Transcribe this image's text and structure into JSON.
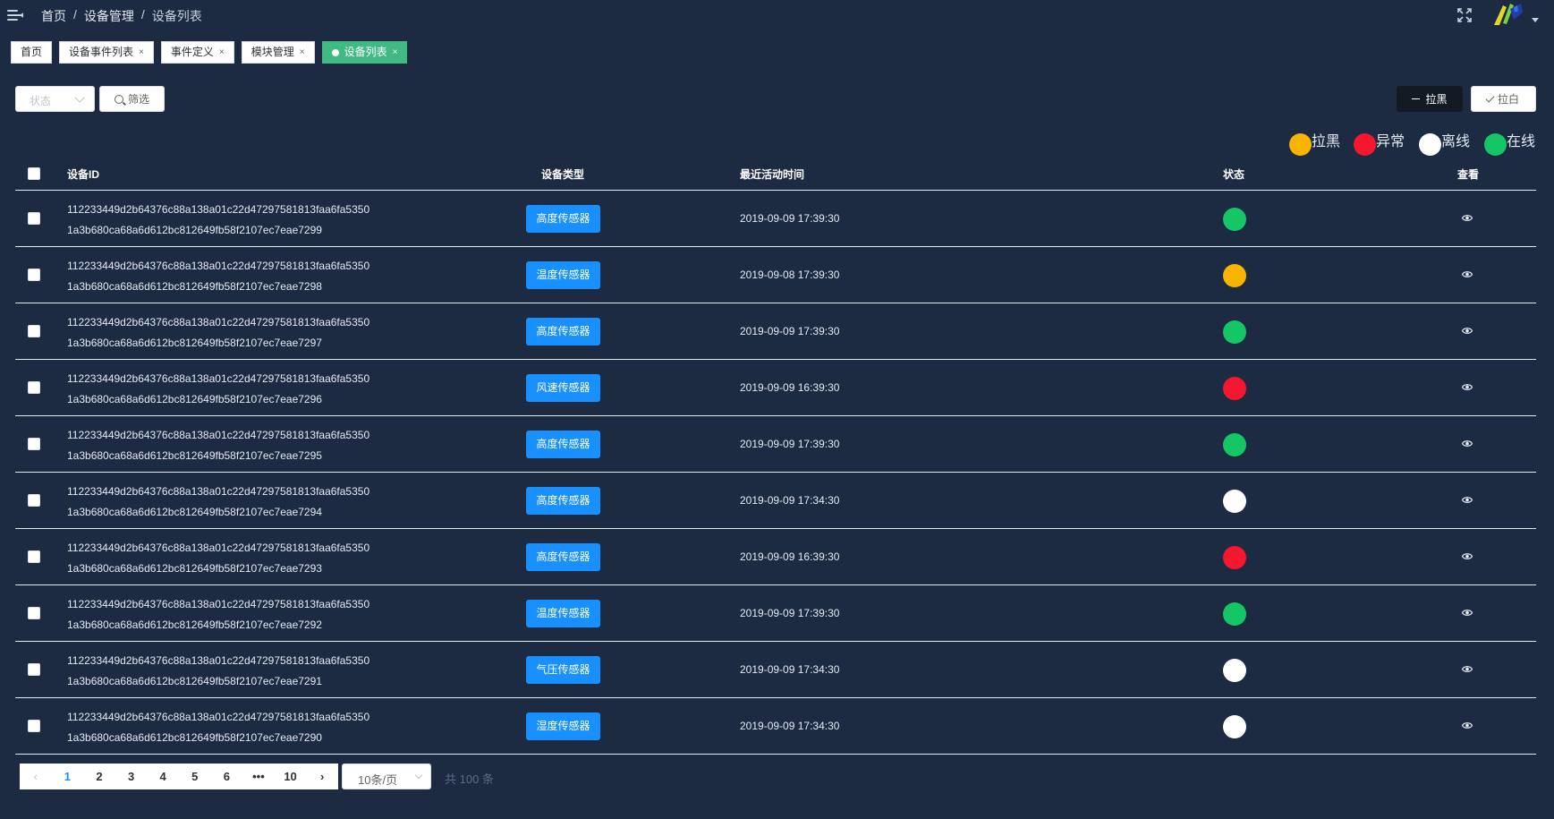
{
  "breadcrumb": {
    "home": "首页",
    "level2": "设备管理",
    "current": "设备列表",
    "separator": "/"
  },
  "tags": [
    {
      "label": "首页",
      "closable": false,
      "active": false
    },
    {
      "label": "设备事件列表",
      "closable": true,
      "active": false
    },
    {
      "label": "事件定义",
      "closable": true,
      "active": false
    },
    {
      "label": "模块管理",
      "closable": true,
      "active": false
    },
    {
      "label": "设备列表",
      "closable": true,
      "active": true
    }
  ],
  "tag_close_glyph": "×",
  "toolbar": {
    "status_placeholder": "状态",
    "filter_label": "筛选",
    "blacklist_label": "拉黑",
    "whitelist_label": "拉白"
  },
  "legend": [
    {
      "label": "拉黑",
      "color": "#f9b400"
    },
    {
      "label": "异常",
      "color": "#f5162f"
    },
    {
      "label": "离线",
      "color": "#ffffff"
    },
    {
      "label": "在线",
      "color": "#14c664"
    }
  ],
  "table": {
    "columns": [
      "设备ID",
      "设备类型",
      "最近活动时间",
      "状态",
      "查看"
    ],
    "rows": [
      {
        "id_line1": "112233449d2b64376c88a138a01c22d47297581813faa6fa5350",
        "id_line2": "1a3b680ca68a6d612bc812649fb58f2107ec7eae7299",
        "type": "高度传感器",
        "time": "2019-09-09 17:39:30",
        "status": "在线"
      },
      {
        "id_line1": "112233449d2b64376c88a138a01c22d47297581813faa6fa5350",
        "id_line2": "1a3b680ca68a6d612bc812649fb58f2107ec7eae7298",
        "type": "温度传感器",
        "time": "2019-09-08 17:39:30",
        "status": "拉黑"
      },
      {
        "id_line1": "112233449d2b64376c88a138a01c22d47297581813faa6fa5350",
        "id_line2": "1a3b680ca68a6d612bc812649fb58f2107ec7eae7297",
        "type": "高度传感器",
        "time": "2019-09-09 17:39:30",
        "status": "在线"
      },
      {
        "id_line1": "112233449d2b64376c88a138a01c22d47297581813faa6fa5350",
        "id_line2": "1a3b680ca68a6d612bc812649fb58f2107ec7eae7296",
        "type": "风速传感器",
        "time": "2019-09-09 16:39:30",
        "status": "异常"
      },
      {
        "id_line1": "112233449d2b64376c88a138a01c22d47297581813faa6fa5350",
        "id_line2": "1a3b680ca68a6d612bc812649fb58f2107ec7eae7295",
        "type": "高度传感器",
        "time": "2019-09-09 17:39:30",
        "status": "在线"
      },
      {
        "id_line1": "112233449d2b64376c88a138a01c22d47297581813faa6fa5350",
        "id_line2": "1a3b680ca68a6d612bc812649fb58f2107ec7eae7294",
        "type": "高度传感器",
        "time": "2019-09-09 17:34:30",
        "status": "离线"
      },
      {
        "id_line1": "112233449d2b64376c88a138a01c22d47297581813faa6fa5350",
        "id_line2": "1a3b680ca68a6d612bc812649fb58f2107ec7eae7293",
        "type": "高度传感器",
        "time": "2019-09-09 16:39:30",
        "status": "异常"
      },
      {
        "id_line1": "112233449d2b64376c88a138a01c22d47297581813faa6fa5350",
        "id_line2": "1a3b680ca68a6d612bc812649fb58f2107ec7eae7292",
        "type": "温度传感器",
        "time": "2019-09-09 17:39:30",
        "status": "在线"
      },
      {
        "id_line1": "112233449d2b64376c88a138a01c22d47297581813faa6fa5350",
        "id_line2": "1a3b680ca68a6d612bc812649fb58f2107ec7eae7291",
        "type": "气压传感器",
        "time": "2019-09-09 17:34:30",
        "status": "离线"
      },
      {
        "id_line1": "112233449d2b64376c88a138a01c22d47297581813faa6fa5350",
        "id_line2": "1a3b680ca68a6d612bc812649fb58f2107ec7eae7290",
        "type": "湿度传感器",
        "time": "2019-09-09 17:34:30",
        "status": "离线"
      }
    ]
  },
  "pagination": {
    "prev_glyph": "‹",
    "next_glyph": "›",
    "pages": [
      "1",
      "2",
      "3",
      "4",
      "5",
      "6",
      "•••",
      "10"
    ],
    "current": "1",
    "page_size": "10条/页",
    "total_text": "共 100 条"
  },
  "icons": {
    "menu": "menu-fold-icon",
    "fullscreen": "fullscreen-icon",
    "search": "search-icon",
    "view": "eye-icon"
  },
  "colors": {
    "background": "#1c2b42",
    "active_tag": "#42b983",
    "type_badge": "#1890ff",
    "blacklist_button": "#131a24"
  }
}
